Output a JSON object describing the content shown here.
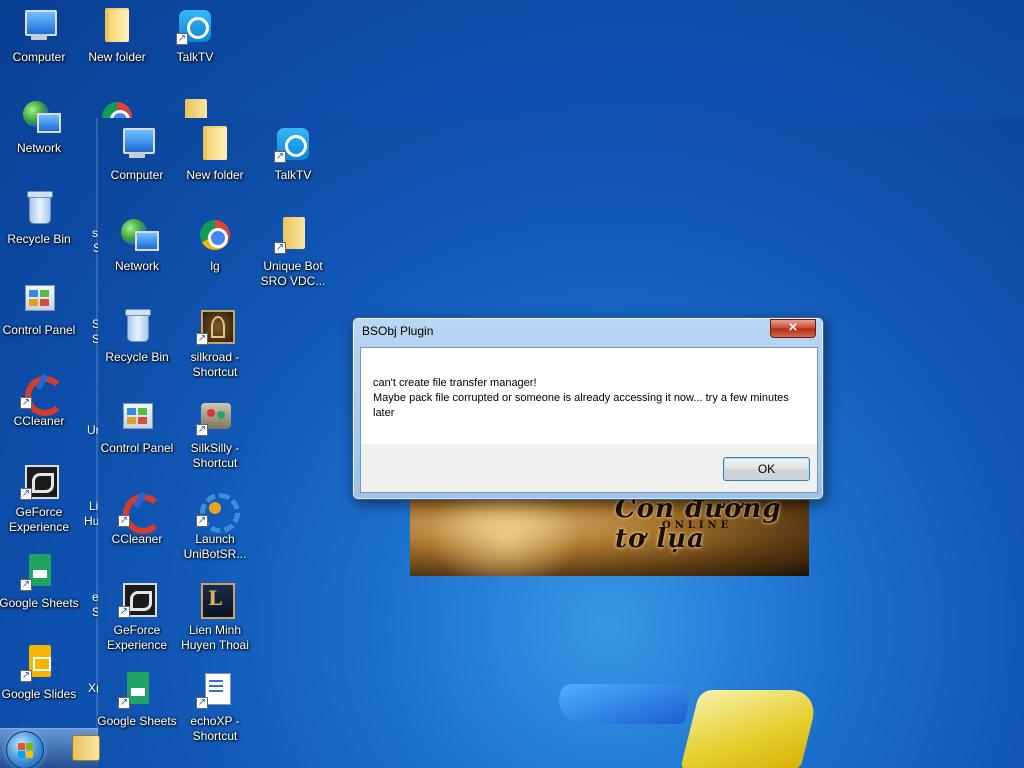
{
  "desktop_back": {
    "icons": [
      {
        "label": "Computer",
        "icon": "computer-icon"
      },
      {
        "label": "New folder",
        "icon": "folder-icon"
      },
      {
        "label": "TalkTV",
        "icon": "talktv-icon"
      },
      {
        "label": "Network",
        "icon": "network-icon"
      },
      {
        "label": "Recycle Bin",
        "icon": "recycle-bin-icon"
      },
      {
        "label": "Control Panel",
        "icon": "control-panel-icon"
      },
      {
        "label": "CCleaner",
        "icon": "ccleaner-icon"
      },
      {
        "label": "GeForce Experience",
        "icon": "geforce-icon"
      },
      {
        "label": "Google Sheets",
        "icon": "google-sheets-icon"
      },
      {
        "label": "Google Slides",
        "icon": "google-slides-icon"
      }
    ],
    "partial_labels": [
      "s",
      "S",
      "S",
      "S",
      "Ur",
      "Li",
      "Hu",
      "e",
      "S",
      "X("
    ]
  },
  "desktop_front": {
    "icons": [
      {
        "label": "Computer",
        "icon": "computer-icon"
      },
      {
        "label": "New folder",
        "icon": "folder-icon"
      },
      {
        "label": "TalkTV",
        "icon": "talktv-icon"
      },
      {
        "label": "Network",
        "icon": "network-icon"
      },
      {
        "label": "lg",
        "icon": "chrome-icon"
      },
      {
        "label": "Unique Bot SRO VDC...",
        "icon": "folder-shortcut-icon"
      },
      {
        "label": "Recycle Bin",
        "icon": "recycle-bin-icon"
      },
      {
        "label": "silkroad - Shortcut",
        "icon": "silkroad-icon"
      },
      {
        "label": "Control Panel",
        "icon": "control-panel-icon"
      },
      {
        "label": "SilkSilly - Shortcut",
        "icon": "silksilly-icon"
      },
      {
        "label": "CCleaner",
        "icon": "ccleaner-icon"
      },
      {
        "label": "Launch UniBotSR...",
        "icon": "unibot-launcher-icon"
      },
      {
        "label": "GeForce Experience",
        "icon": "geforce-icon"
      },
      {
        "label": "Lien Minh Huyen Thoai",
        "icon": "league-of-legends-icon"
      },
      {
        "label": "Google Sheets",
        "icon": "google-sheets-icon"
      },
      {
        "label": "echoXP - Shortcut",
        "icon": "echoxp-icon"
      }
    ]
  },
  "banner": {
    "logo_text": "Con đường tơ lụa",
    "sub_text": "ONLINE"
  },
  "dialog": {
    "title": "BSObj Plugin",
    "close_glyph": "×",
    "message_line1": "can't create file transfer manager!",
    "message_line2": "Maybe pack file corrupted or someone is already accessing it now... try a few minutes later",
    "ok_label": "OK"
  },
  "taskbar": {
    "start_icon": "windows-start-icon",
    "pinned": [
      "explorer-icon"
    ]
  },
  "colors": {
    "desktop_blue": "#1a6ccb",
    "dialog_frame": "#b9d6f2",
    "close_red": "#c9452e"
  }
}
